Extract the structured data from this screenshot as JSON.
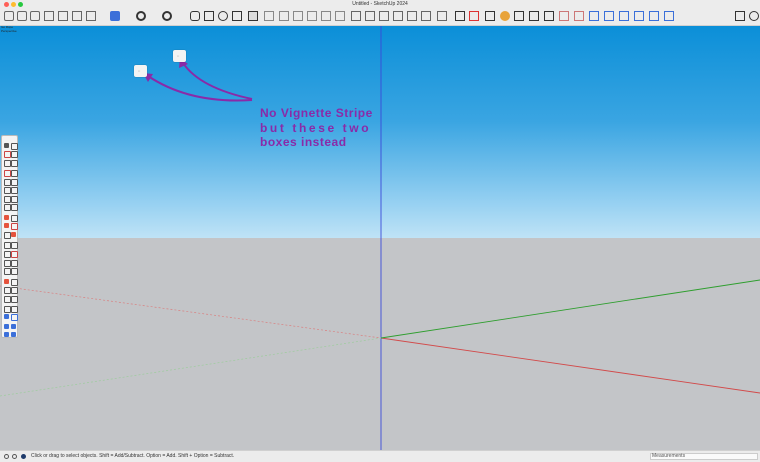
{
  "window": {
    "title": "Untitled - SketchUp 2024",
    "traffic_colors": [
      "#ff5f57",
      "#febc2e",
      "#28c840"
    ]
  },
  "scene": {
    "style_label": "Iso Rope",
    "camera_label": "Perspective"
  },
  "annotation": {
    "line1": "No Vignette Stripe",
    "line2": "but these two",
    "line3": "boxes instead",
    "color": "#8a2aa8"
  },
  "axes": {
    "red": "#d24a4a",
    "green": "#2e9e2e",
    "blue": "#3a4ad8"
  },
  "status": {
    "hint": "Click or drag to select objects. Shift = Add/Subtract. Option = Add. Shift + Option = Subtract.",
    "measurements_label": "Measurements"
  }
}
